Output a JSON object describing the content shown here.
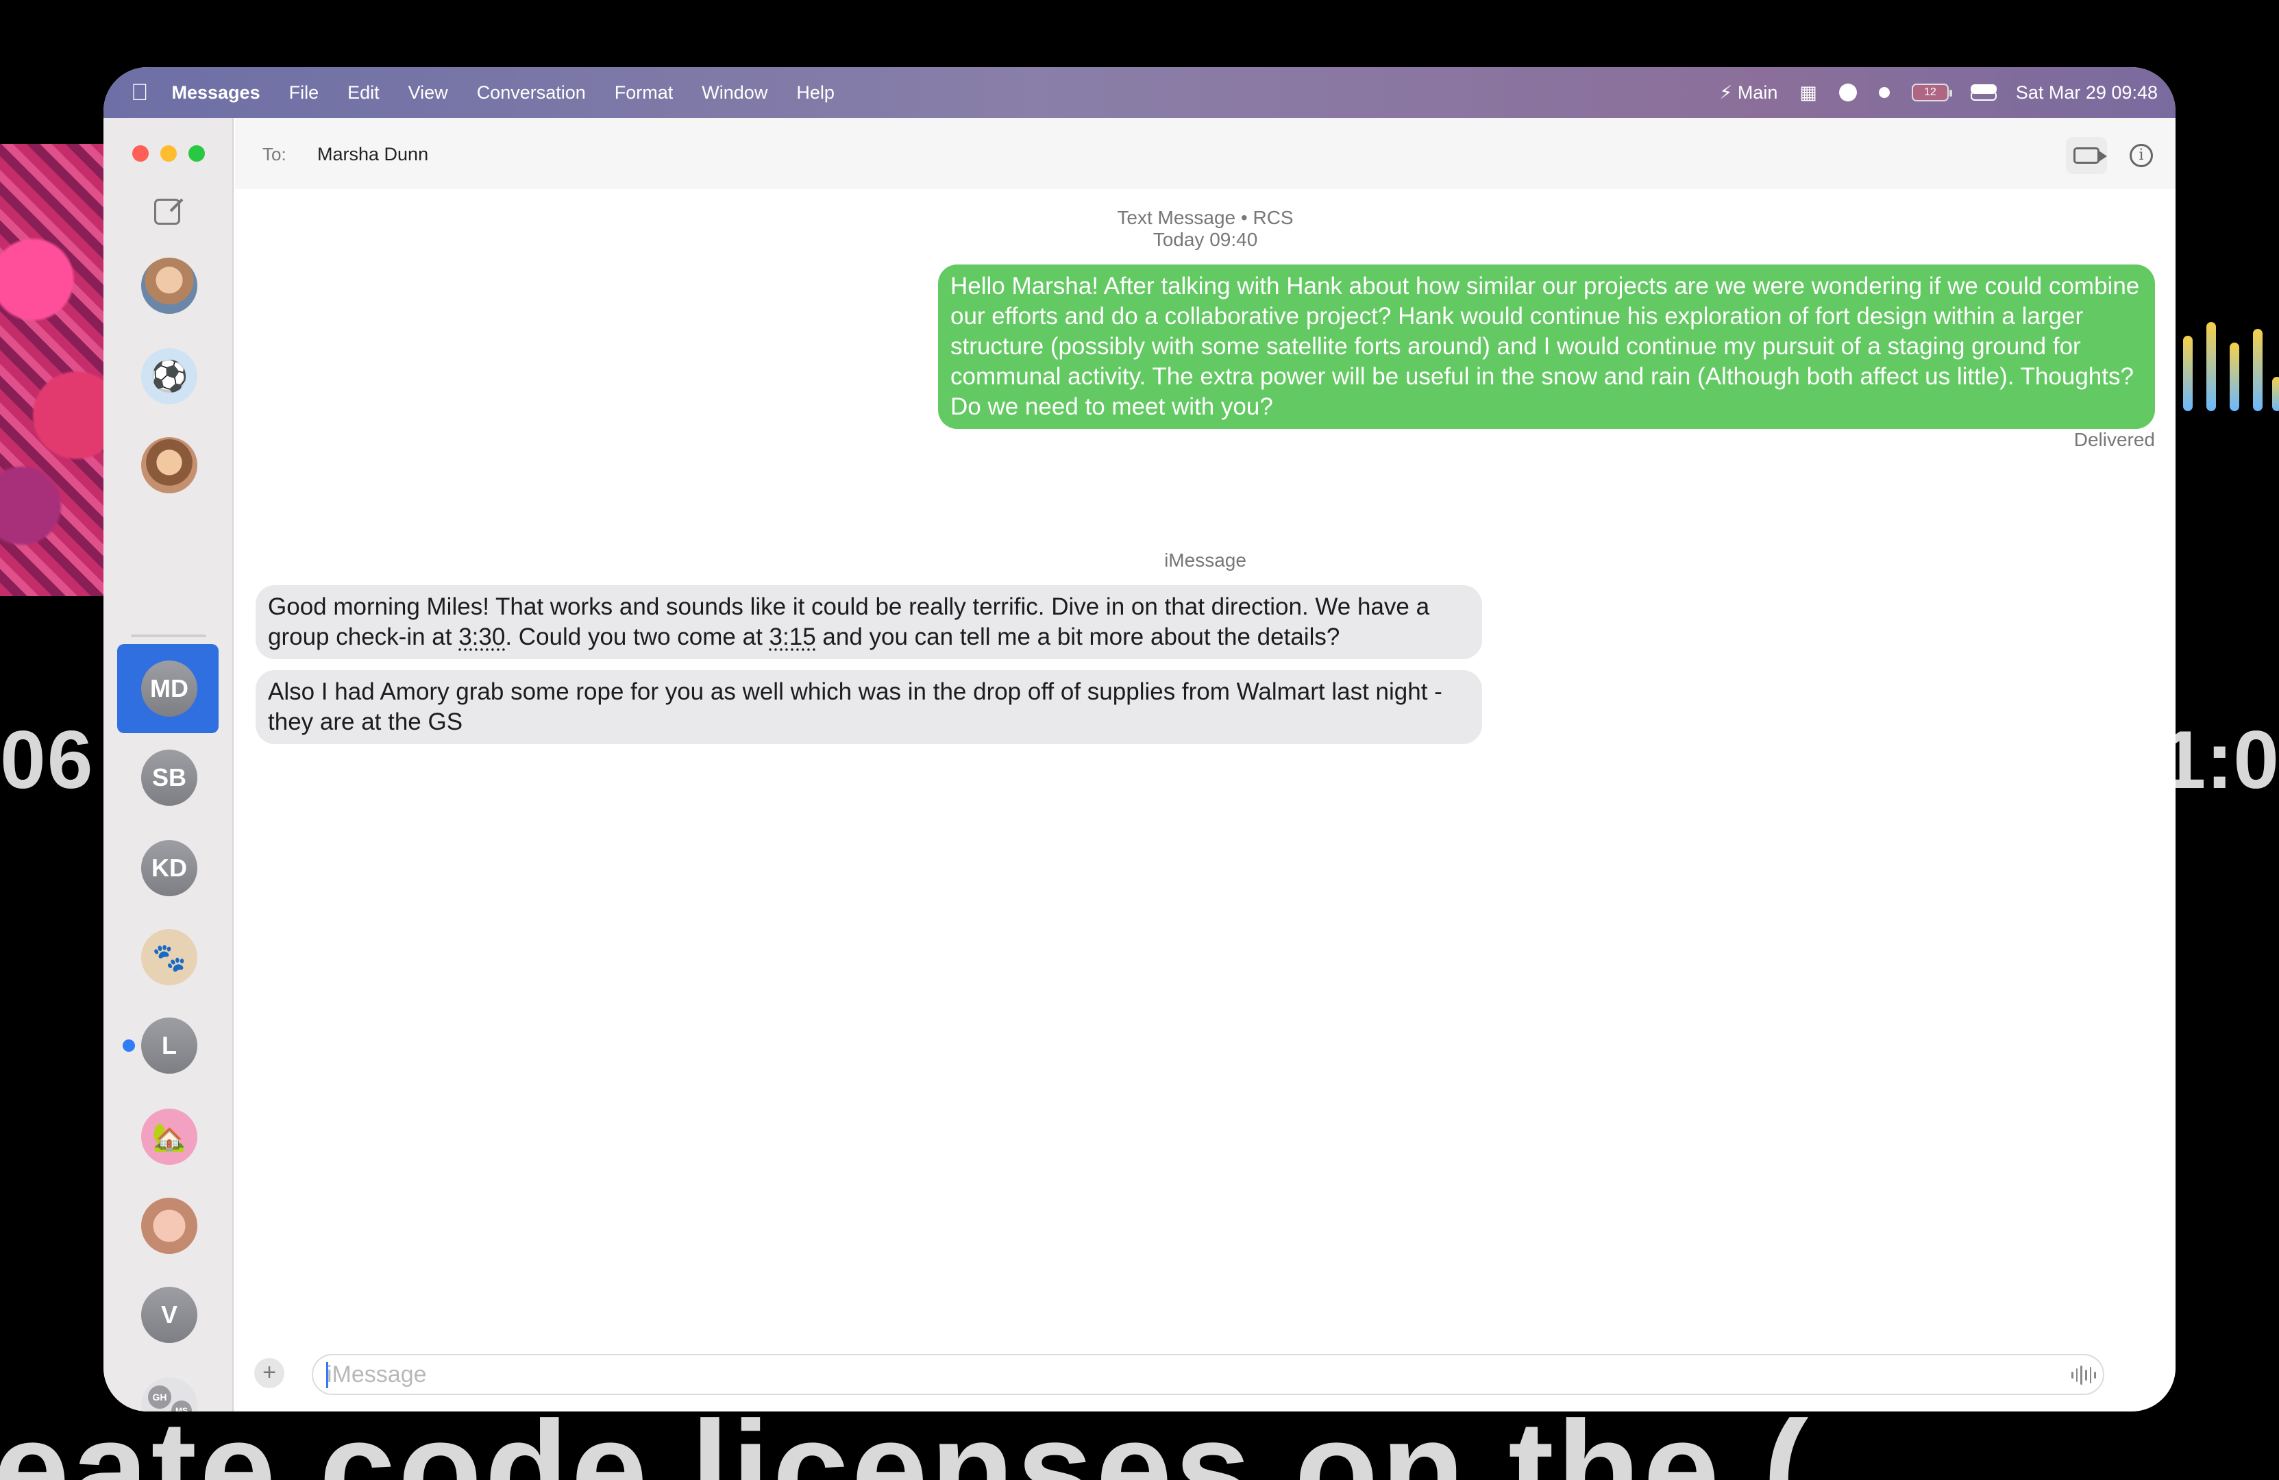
{
  "menubar": {
    "app_name": "Messages",
    "menus": [
      "File",
      "Edit",
      "View",
      "Conversation",
      "Format",
      "Window",
      "Help"
    ],
    "status": {
      "focus_label": "Main",
      "battery": "12",
      "datetime": "Sat Mar 29  09:48"
    }
  },
  "background": {
    "left_text": "06",
    "right_text": "1:0",
    "caption": "eate code licenses on the ("
  },
  "sidebar": {
    "conversations": [
      {
        "name": "photo-contact-1",
        "type": "photo"
      },
      {
        "name": "soccer-group",
        "type": "emoji",
        "icon": "⚽"
      },
      {
        "name": "photo-contact-2",
        "type": "photo"
      },
      {
        "name": "MD",
        "type": "initials",
        "initials": "MD",
        "selected": true
      },
      {
        "name": "SB",
        "type": "initials",
        "initials": "SB"
      },
      {
        "name": "KD",
        "type": "initials",
        "initials": "KD"
      },
      {
        "name": "paws-group",
        "type": "emoji",
        "icon": "🐾"
      },
      {
        "name": "L",
        "type": "initials",
        "initials": "L",
        "unread": true
      },
      {
        "name": "house-group",
        "type": "emoji",
        "icon": "🏡"
      },
      {
        "name": "photo-contact-3",
        "type": "photo"
      },
      {
        "name": "V",
        "type": "initials",
        "initials": "V"
      },
      {
        "name": "group-GH-MS",
        "type": "group",
        "initials": [
          "GH",
          "MS"
        ]
      },
      {
        "name": "unknown-contact",
        "type": "person"
      }
    ]
  },
  "header": {
    "to_label": "To:",
    "recipient": "Marsha Dunn"
  },
  "thread": {
    "service_line": "Text Message • RCS",
    "time_line": "Today 09:40",
    "sent_message": "Hello Marsha! After talking with Hank about how similar our projects are we were wondering if we could combine our efforts and do a collaborative project? Hank would continue his exploration of fort design within a larger structure (possibly with some satellite forts around) and I would continue my pursuit of a staging ground for communal activity. The extra power will be useful in the snow and rain (Although both affect us little). Thoughts? Do we need to meet with you?",
    "delivered_label": "Delivered",
    "imessage_label": "iMessage",
    "received_1": {
      "part1": "Good morning Miles! That works and sounds like it could be really terrific. Dive in on that direction. We have a group check-in at ",
      "time1": "3:30",
      "part2": ". Could you two come at ",
      "time2": "3:15",
      "part3": " and you can tell me a bit more about the details?"
    },
    "received_2": "Also I had Amory grab some rope for you as well which was in the drop off of supplies from Walmart last night - they are at the GS"
  },
  "composer": {
    "placeholder": "iMessage",
    "value": ""
  },
  "colors": {
    "sent_bubble": "#63c962",
    "received_bubble": "#e9e9eb",
    "selection": "#2f6fe0",
    "unread_dot": "#2f7df6",
    "close": "#ff5f57",
    "minimize": "#febc2e",
    "zoom": "#28c840"
  }
}
